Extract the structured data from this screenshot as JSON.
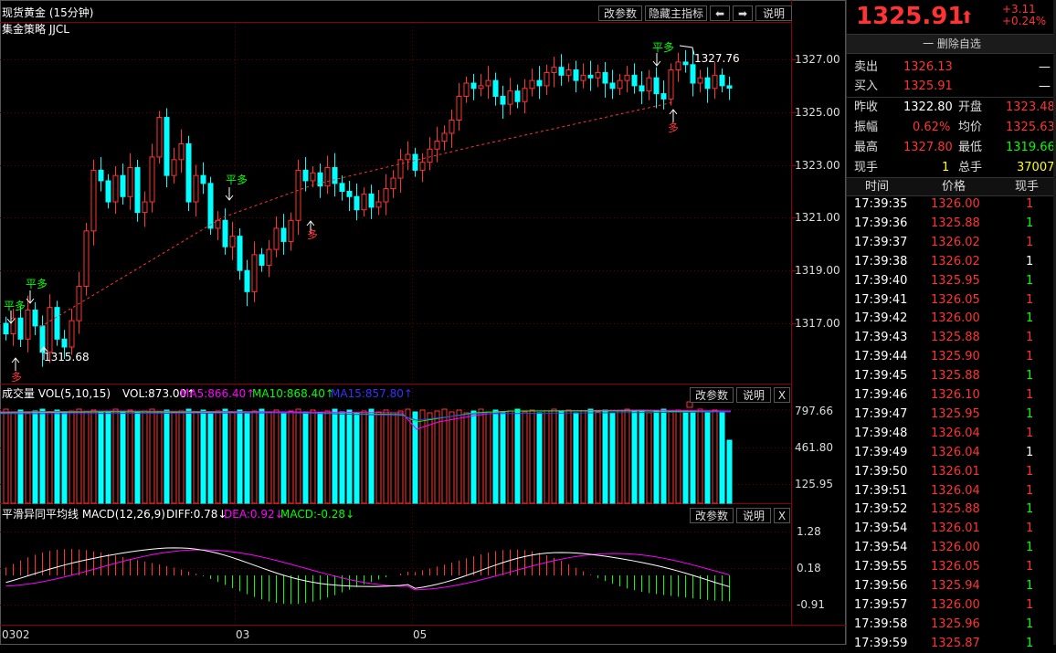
{
  "main_chart": {
    "title": "现货黄金 (15分钟)",
    "indicator": "集金策略 JJCL",
    "buttons": {
      "params": "改参数",
      "hide": "隐藏主指标",
      "prev": "⬅",
      "next": "➡",
      "help": "说明"
    },
    "price_axis": [
      "1327.00",
      "1325.00",
      "1323.00",
      "1321.00",
      "1319.00",
      "1317.00"
    ],
    "annotations": {
      "high_label": "1327.76",
      "low_label": "1315.68",
      "signal_flat_long": "平多",
      "signal_long": "多"
    }
  },
  "volume_panel": {
    "title": "成交量 VOL(5,10,15)",
    "vol": "VOL:873.00↑",
    "ma5": "MA5:866.40↑",
    "ma10": "MA10:868.40↑",
    "ma15": "MA15:857.80↑",
    "axis": [
      "797.66",
      "461.80",
      "125.95"
    ],
    "buttons": {
      "params": "改参数",
      "help": "说明",
      "close": "X"
    }
  },
  "macd_panel": {
    "title": "平滑异同平均线 MACD(12,26,9)",
    "diff": "DIFF:0.78↓",
    "dea": "DEA:0.92↓",
    "macd": "MACD:-0.28↓",
    "axis": [
      "1.28",
      "0.18",
      "-0.91"
    ],
    "buttons": {
      "params": "改参数",
      "help": "说明",
      "close": "X"
    }
  },
  "time_axis": [
    "0302",
    "03",
    "05"
  ],
  "quote": {
    "price": "1325.91",
    "change": "+3.11",
    "change_pct": "+0.24%",
    "delete_watch": "一 删除自选",
    "sell_label": "卖出",
    "sell_price": "1326.13",
    "sell_vol": "—",
    "buy_label": "买入",
    "buy_price": "1325.91",
    "buy_vol": "—",
    "prev_close_label": "昨收",
    "prev_close": "1322.80",
    "open_label": "开盘",
    "open": "1323.48",
    "amplitude_label": "振幅",
    "amplitude": "0.62%",
    "avg_label": "均价",
    "avg": "1325.63",
    "high_label": "最高",
    "high": "1327.80",
    "low_label": "最低",
    "low": "1319.66",
    "cur_vol_label": "现手",
    "cur_vol": "1",
    "total_vol_label": "总手",
    "total_vol": "37007"
  },
  "ticks": {
    "headers": [
      "时间",
      "价格",
      "现手"
    ],
    "rows": [
      [
        "17:39:35",
        "1326.00",
        "1"
      ],
      [
        "17:39:36",
        "1325.88",
        "1"
      ],
      [
        "17:39:37",
        "1326.02",
        "1"
      ],
      [
        "17:39:38",
        "1326.02",
        "1"
      ],
      [
        "17:39:40",
        "1325.95",
        "1"
      ],
      [
        "17:39:41",
        "1326.05",
        "1"
      ],
      [
        "17:39:42",
        "1326.00",
        "1"
      ],
      [
        "17:39:43",
        "1325.88",
        "1"
      ],
      [
        "17:39:44",
        "1325.90",
        "1"
      ],
      [
        "17:39:45",
        "1325.88",
        "1"
      ],
      [
        "17:39:46",
        "1326.10",
        "1"
      ],
      [
        "17:39:47",
        "1325.95",
        "1"
      ],
      [
        "17:39:48",
        "1326.04",
        "1"
      ],
      [
        "17:39:49",
        "1326.04",
        "1"
      ],
      [
        "17:39:50",
        "1326.01",
        "1"
      ],
      [
        "17:39:51",
        "1326.04",
        "1"
      ],
      [
        "17:39:52",
        "1325.88",
        "1"
      ],
      [
        "17:39:54",
        "1326.01",
        "1"
      ],
      [
        "17:39:54",
        "1326.00",
        "1"
      ],
      [
        "17:39:55",
        "1326.05",
        "1"
      ],
      [
        "17:39:56",
        "1325.94",
        "1"
      ],
      [
        "17:39:57",
        "1326.00",
        "1"
      ],
      [
        "17:39:58",
        "1325.96",
        "1"
      ],
      [
        "17:39:59",
        "1325.87",
        "1"
      ]
    ],
    "vol_colors": [
      "red",
      "grn",
      "red",
      "wht",
      "grn",
      "red",
      "grn",
      "red",
      "red",
      "grn",
      "red",
      "grn",
      "red",
      "wht",
      "red",
      "red",
      "grn",
      "red",
      "grn",
      "red",
      "grn",
      "red",
      "grn",
      "grn"
    ]
  },
  "colors": {
    "up": "#ff3333",
    "down": "#00ffff",
    "grid": "#8b0000",
    "ma5": "#ff00ff",
    "ma10": "#00ff00",
    "ma15": "#3333ff",
    "macd_up": "#ff3333",
    "macd_down": "#00ff00"
  }
}
